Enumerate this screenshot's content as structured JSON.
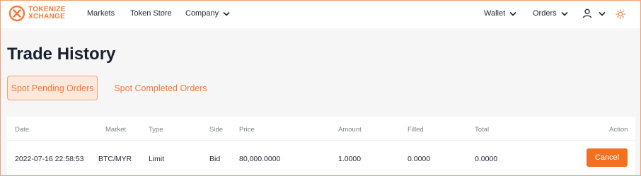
{
  "brand": {
    "line1": "TOKENIZE",
    "line2": "XCHANGE",
    "accent": "#f47a3a"
  },
  "nav": {
    "markets": "Markets",
    "token_store": "Token Store",
    "company": "Company",
    "wallet": "Wallet",
    "orders": "Orders"
  },
  "icons": {
    "user": "user-icon",
    "theme": "sun-icon",
    "dropdown": "chevron-down-icon"
  },
  "page": {
    "title": "Trade History"
  },
  "tabs": [
    {
      "label": "Spot Pending Orders",
      "active": true
    },
    {
      "label": "Spot Completed Orders",
      "active": false
    }
  ],
  "table": {
    "columns": [
      "Date",
      "Market",
      "Type",
      "Side",
      "Price",
      "Amount",
      "Filled",
      "Total",
      "Action"
    ],
    "rows": [
      {
        "date": "2022-07-16 22:58:53",
        "market": "BTC/MYR",
        "type": "Limit",
        "side": "Bid",
        "price": "80,000.0000",
        "amount": "1.0000",
        "filled": "0.0000",
        "total": "0.0000",
        "action": "Cancel"
      }
    ]
  },
  "colors": {
    "button": "#f5701e",
    "active_tab_bg": "#fde8dc",
    "page_bg": "#f6f6f6"
  }
}
